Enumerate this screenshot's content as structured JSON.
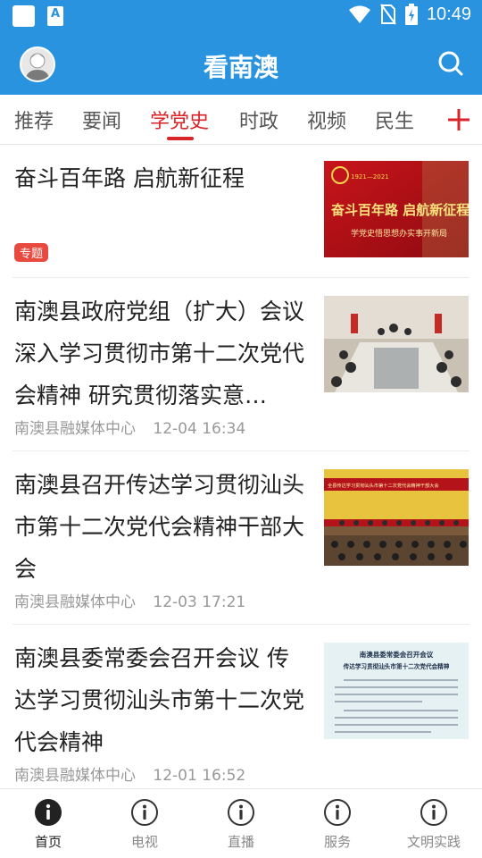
{
  "status_bar": {
    "time": "10:49",
    "notification_letter": "A"
  },
  "app_bar": {
    "title": "看南澳"
  },
  "tabs": [
    {
      "label": "推荐"
    },
    {
      "label": "要闻"
    },
    {
      "label": "学党史"
    },
    {
      "label": "时政"
    },
    {
      "label": "视频"
    },
    {
      "label": "民生"
    }
  ],
  "active_tab": "学党史",
  "articles": [
    {
      "title": "奋斗百年路 启航新征程",
      "badge": "专题",
      "thumb_caption": "奋斗百年路 启航新征程",
      "thumb_subcaption": "学党史悟思想办实事开新局",
      "thumb_years": "1921—2021"
    },
    {
      "title": "南澳县政府党组（扩大）会议 深入学习贯彻市第十二次党代会精神 研究贯彻落实意…",
      "source": "南澳县融媒体中心",
      "time": "12-04 16:34"
    },
    {
      "title": "南澳县召开传达学习贯彻汕头市第十二次党代会精神干部大会",
      "source": "南澳县融媒体中心",
      "time": "12-03 17:21",
      "thumb_caption": "全县传达学习贯彻汕头市第十二次党代会精神干部大会"
    },
    {
      "title": "南澳县委常委会召开会议 传达学习贯彻汕头市第十二次党代会精神",
      "source": "南澳县融媒体中心",
      "time": "12-01 16:52",
      "thumb_heading": "南澳县委常委会召开会议",
      "thumb_subheading": "传达学习贯彻汕头市第十二次党代会精神"
    }
  ],
  "bottom_nav": [
    {
      "label": "首页",
      "icon": "info-icon"
    },
    {
      "label": "电视",
      "icon": "info-icon"
    },
    {
      "label": "直播",
      "icon": "info-icon"
    },
    {
      "label": "服务",
      "icon": "info-icon"
    },
    {
      "label": "文明实践",
      "icon": "info-icon"
    }
  ],
  "colors": {
    "primary": "#2a93e0",
    "accent": "#d9242a",
    "badge": "#e94a3f"
  }
}
